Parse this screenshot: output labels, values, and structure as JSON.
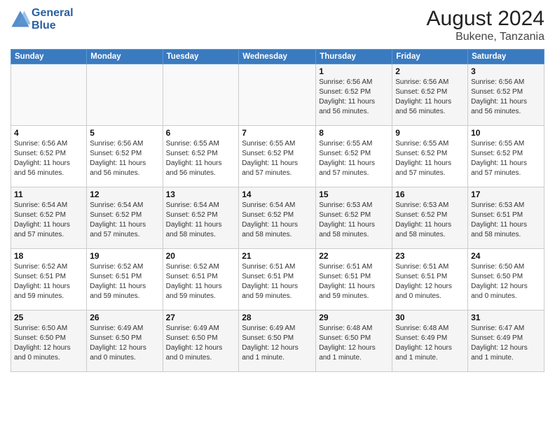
{
  "header": {
    "logo_line1": "General",
    "logo_line2": "Blue",
    "main_title": "August 2024",
    "subtitle": "Bukene, Tanzania"
  },
  "days_of_week": [
    "Sunday",
    "Monday",
    "Tuesday",
    "Wednesday",
    "Thursday",
    "Friday",
    "Saturday"
  ],
  "weeks": [
    [
      {
        "day": "",
        "info": ""
      },
      {
        "day": "",
        "info": ""
      },
      {
        "day": "",
        "info": ""
      },
      {
        "day": "",
        "info": ""
      },
      {
        "day": "1",
        "info": "Sunrise: 6:56 AM\nSunset: 6:52 PM\nDaylight: 11 hours\nand 56 minutes."
      },
      {
        "day": "2",
        "info": "Sunrise: 6:56 AM\nSunset: 6:52 PM\nDaylight: 11 hours\nand 56 minutes."
      },
      {
        "day": "3",
        "info": "Sunrise: 6:56 AM\nSunset: 6:52 PM\nDaylight: 11 hours\nand 56 minutes."
      }
    ],
    [
      {
        "day": "4",
        "info": "Sunrise: 6:56 AM\nSunset: 6:52 PM\nDaylight: 11 hours\nand 56 minutes."
      },
      {
        "day": "5",
        "info": "Sunrise: 6:56 AM\nSunset: 6:52 PM\nDaylight: 11 hours\nand 56 minutes."
      },
      {
        "day": "6",
        "info": "Sunrise: 6:55 AM\nSunset: 6:52 PM\nDaylight: 11 hours\nand 56 minutes."
      },
      {
        "day": "7",
        "info": "Sunrise: 6:55 AM\nSunset: 6:52 PM\nDaylight: 11 hours\nand 57 minutes."
      },
      {
        "day": "8",
        "info": "Sunrise: 6:55 AM\nSunset: 6:52 PM\nDaylight: 11 hours\nand 57 minutes."
      },
      {
        "day": "9",
        "info": "Sunrise: 6:55 AM\nSunset: 6:52 PM\nDaylight: 11 hours\nand 57 minutes."
      },
      {
        "day": "10",
        "info": "Sunrise: 6:55 AM\nSunset: 6:52 PM\nDaylight: 11 hours\nand 57 minutes."
      }
    ],
    [
      {
        "day": "11",
        "info": "Sunrise: 6:54 AM\nSunset: 6:52 PM\nDaylight: 11 hours\nand 57 minutes."
      },
      {
        "day": "12",
        "info": "Sunrise: 6:54 AM\nSunset: 6:52 PM\nDaylight: 11 hours\nand 57 minutes."
      },
      {
        "day": "13",
        "info": "Sunrise: 6:54 AM\nSunset: 6:52 PM\nDaylight: 11 hours\nand 58 minutes."
      },
      {
        "day": "14",
        "info": "Sunrise: 6:54 AM\nSunset: 6:52 PM\nDaylight: 11 hours\nand 58 minutes."
      },
      {
        "day": "15",
        "info": "Sunrise: 6:53 AM\nSunset: 6:52 PM\nDaylight: 11 hours\nand 58 minutes."
      },
      {
        "day": "16",
        "info": "Sunrise: 6:53 AM\nSunset: 6:52 PM\nDaylight: 11 hours\nand 58 minutes."
      },
      {
        "day": "17",
        "info": "Sunrise: 6:53 AM\nSunset: 6:51 PM\nDaylight: 11 hours\nand 58 minutes."
      }
    ],
    [
      {
        "day": "18",
        "info": "Sunrise: 6:52 AM\nSunset: 6:51 PM\nDaylight: 11 hours\nand 59 minutes."
      },
      {
        "day": "19",
        "info": "Sunrise: 6:52 AM\nSunset: 6:51 PM\nDaylight: 11 hours\nand 59 minutes."
      },
      {
        "day": "20",
        "info": "Sunrise: 6:52 AM\nSunset: 6:51 PM\nDaylight: 11 hours\nand 59 minutes."
      },
      {
        "day": "21",
        "info": "Sunrise: 6:51 AM\nSunset: 6:51 PM\nDaylight: 11 hours\nand 59 minutes."
      },
      {
        "day": "22",
        "info": "Sunrise: 6:51 AM\nSunset: 6:51 PM\nDaylight: 11 hours\nand 59 minutes."
      },
      {
        "day": "23",
        "info": "Sunrise: 6:51 AM\nSunset: 6:51 PM\nDaylight: 12 hours\nand 0 minutes."
      },
      {
        "day": "24",
        "info": "Sunrise: 6:50 AM\nSunset: 6:50 PM\nDaylight: 12 hours\nand 0 minutes."
      }
    ],
    [
      {
        "day": "25",
        "info": "Sunrise: 6:50 AM\nSunset: 6:50 PM\nDaylight: 12 hours\nand 0 minutes."
      },
      {
        "day": "26",
        "info": "Sunrise: 6:49 AM\nSunset: 6:50 PM\nDaylight: 12 hours\nand 0 minutes."
      },
      {
        "day": "27",
        "info": "Sunrise: 6:49 AM\nSunset: 6:50 PM\nDaylight: 12 hours\nand 0 minutes."
      },
      {
        "day": "28",
        "info": "Sunrise: 6:49 AM\nSunset: 6:50 PM\nDaylight: 12 hours\nand 1 minute."
      },
      {
        "day": "29",
        "info": "Sunrise: 6:48 AM\nSunset: 6:50 PM\nDaylight: 12 hours\nand 1 minute."
      },
      {
        "day": "30",
        "info": "Sunrise: 6:48 AM\nSunset: 6:49 PM\nDaylight: 12 hours\nand 1 minute."
      },
      {
        "day": "31",
        "info": "Sunrise: 6:47 AM\nSunset: 6:49 PM\nDaylight: 12 hours\nand 1 minute."
      }
    ]
  ]
}
